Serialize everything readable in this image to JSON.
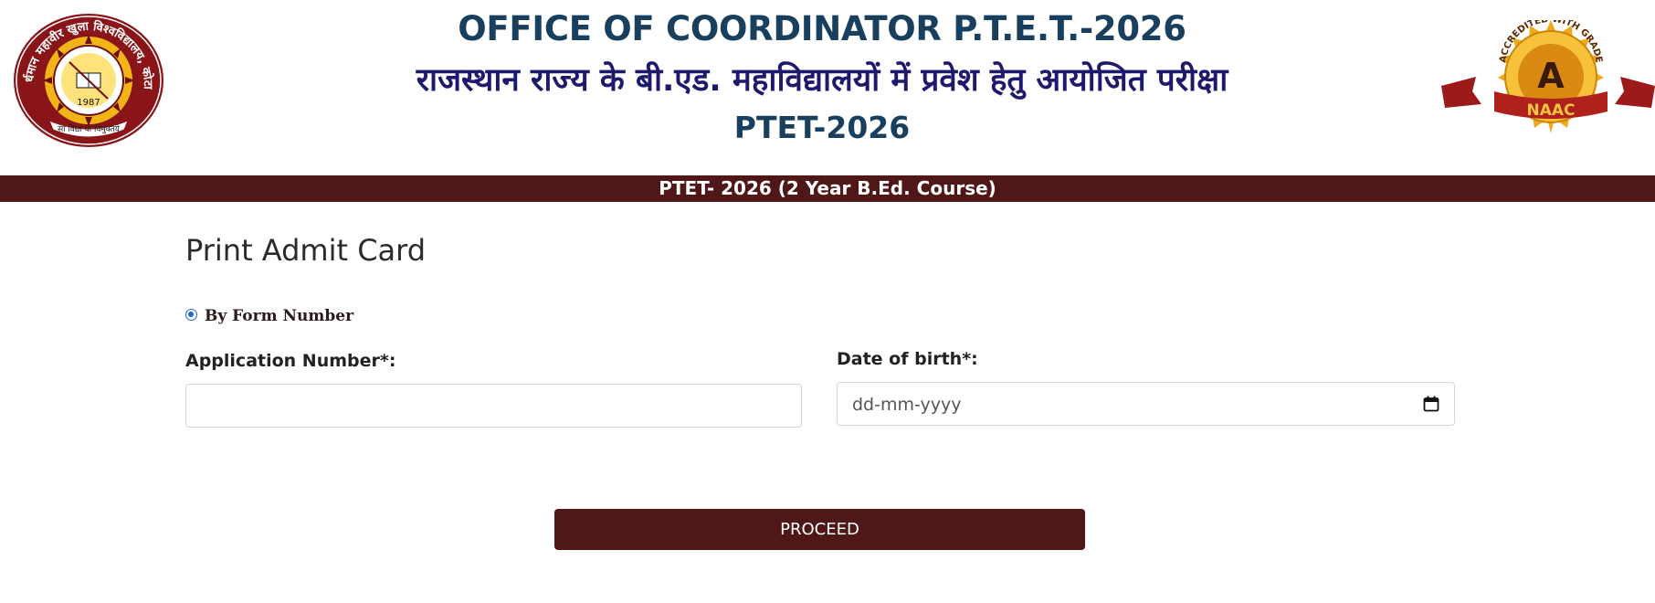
{
  "header": {
    "title_en": "OFFICE OF COORDINATOR P.T.E.T.-2026",
    "title_hi": "राजस्थान राज्य के बी.एड. महाविद्यालयों में प्रवेश हेतु आयोजित परीक्षा",
    "title_code": "PTET-2026",
    "left_logo": {
      "icon": "university-seal",
      "arc_text": "वर्धमान महावीर खुला विश्वविद्यालय, कोटा",
      "year": "1987",
      "motto": "सा विद्या या विमुक्तये"
    },
    "right_logo": {
      "icon": "naac-badge",
      "grade": "A",
      "ribbon": "NAAC",
      "arc_text": "ACCREDITED WITH GRADE"
    }
  },
  "course_bar": {
    "text": "PTET- 2026 (2 Year B.Ed. Course)"
  },
  "form": {
    "title": "Print Admit Card",
    "radio_label": "By Form Number",
    "radio_selected": true,
    "application_label": "Application Number*:",
    "application_value": "",
    "dob_label": "Date of birth*:",
    "dob_placeholder": "dd-mm-yyyy",
    "proceed_label": "PROCEED"
  },
  "colors": {
    "maroon": "#4f1718",
    "title_blue": "#183f5e",
    "hindi_navy": "#1d1a6d",
    "radio_blue": "#1a6bd0"
  }
}
